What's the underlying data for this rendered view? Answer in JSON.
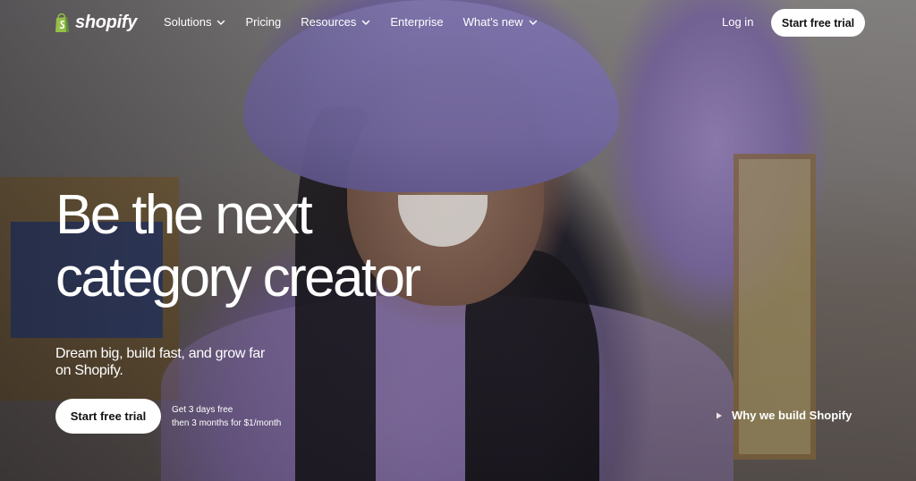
{
  "nav": {
    "logo_text": "shopify",
    "links": [
      {
        "label": "Solutions",
        "has_dropdown": true
      },
      {
        "label": "Pricing",
        "has_dropdown": false
      },
      {
        "label": "Resources",
        "has_dropdown": true
      },
      {
        "label": "Enterprise",
        "has_dropdown": false
      },
      {
        "label": "What’s new",
        "has_dropdown": true
      }
    ],
    "login_label": "Log in",
    "cta_label": "Start free trial"
  },
  "hero": {
    "headline_line1": "Be the next",
    "headline_line2": "category creator",
    "subtitle": "Dream big, build fast, and grow far on Shopify.",
    "cta_label": "Start free trial",
    "trial_note_line1": "Get 3 days free",
    "trial_note_line2": "then 3 months for $1/month",
    "why_label": "Why we build Shopify"
  },
  "icons": {
    "logo": "shopify-bag-icon",
    "dropdown": "chevron-down-icon",
    "video": "play-icon"
  },
  "colors": {
    "logo_green": "#95bf47",
    "text": "#ffffff",
    "button_bg": "#ffffff",
    "button_text": "#111111"
  }
}
